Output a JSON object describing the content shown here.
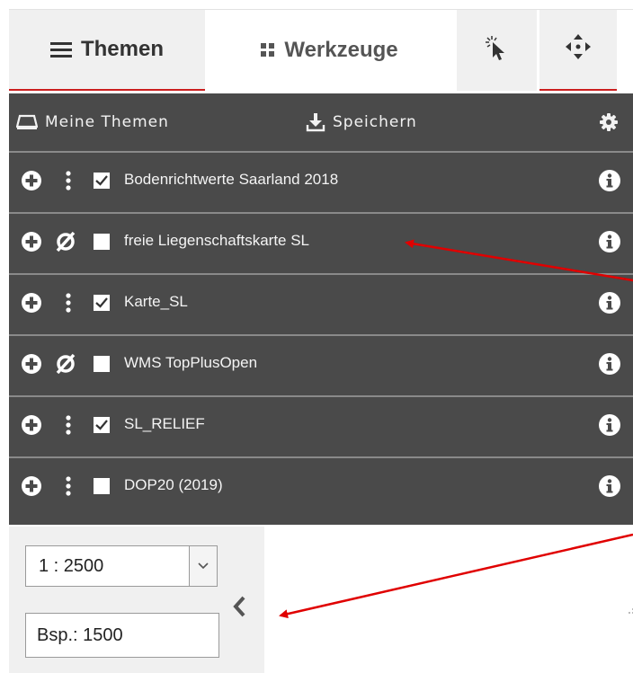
{
  "tabs": {
    "themes_label": "Themen",
    "tools_label": "Werkzeuge",
    "select_icon": "cursor-click-icon",
    "move_icon": "move-arrows-icon"
  },
  "panel_header": {
    "my_themes_label": "Meine Themen",
    "save_label": "Speichern",
    "settings_icon": "gear-icon"
  },
  "layers": [
    {
      "label": "Bodenrichtwerte Saarland 2018",
      "visible": true,
      "checked": true
    },
    {
      "label": "freie Liegenschaftskarte SL",
      "visible": false,
      "checked": false
    },
    {
      "label": "Karte_SL",
      "visible": true,
      "checked": true
    },
    {
      "label": "WMS TopPlusOpen",
      "visible": false,
      "checked": false
    },
    {
      "label": "SL_RELIEF",
      "visible": true,
      "checked": true
    },
    {
      "label": "DOP20 (2019)",
      "visible": true,
      "checked": false
    }
  ],
  "scale": {
    "selected": "1 : 2500",
    "input_value": "Bsp.: 1500"
  },
  "colors": {
    "panel": "#4a4a4a",
    "tab_accent": "#cc1f1f",
    "annotation_arrow": "#e00000"
  }
}
